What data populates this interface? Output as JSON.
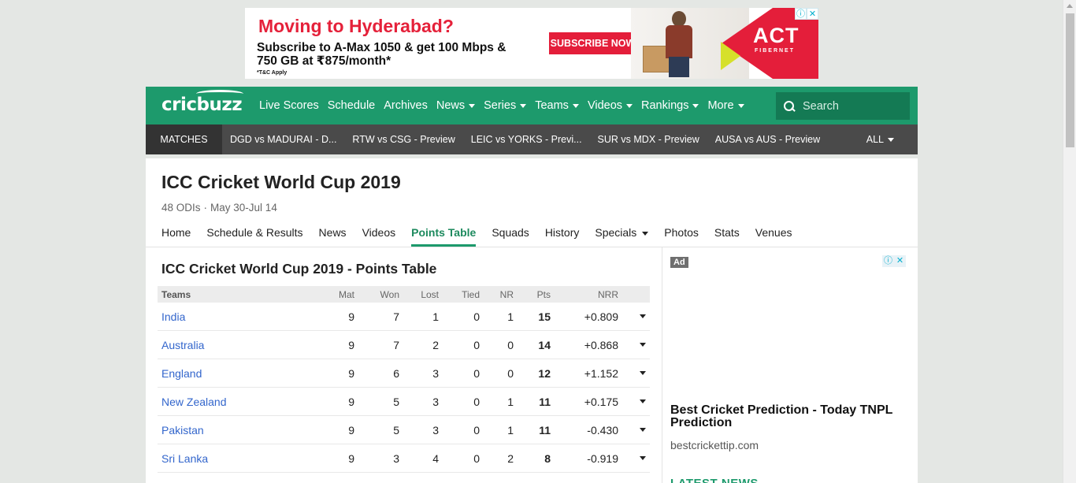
{
  "ad_banner": {
    "headline": "Moving to Hyderabad?",
    "subline": "Subscribe to A-Max 1050 & get 100 Mbps & 750 GB at ₹875/month*",
    "tnc": "*T&C Apply",
    "cta": "SUBSCRIBE NOW",
    "brand": "ACT",
    "brand_sub": "FIBERNET",
    "info_glyph": "ⓘ",
    "close_glyph": "✕"
  },
  "nav": {
    "logo": "cricbuzz",
    "items": [
      {
        "label": "Live Scores",
        "has_menu": false
      },
      {
        "label": "Schedule",
        "has_menu": false
      },
      {
        "label": "Archives",
        "has_menu": false
      },
      {
        "label": "News",
        "has_menu": true
      },
      {
        "label": "Series",
        "has_menu": true
      },
      {
        "label": "Teams",
        "has_menu": true
      },
      {
        "label": "Videos",
        "has_menu": true
      },
      {
        "label": "Rankings",
        "has_menu": true
      },
      {
        "label": "More",
        "has_menu": true
      }
    ],
    "search_placeholder": "Search"
  },
  "matches_bar": {
    "label": "MATCHES",
    "matches": [
      "DGD vs MADURAI - D...",
      "RTW vs CSG - Preview",
      "LEIC vs YORKS - Previ...",
      "SUR vs MDX - Preview",
      "AUSA vs AUS - Preview"
    ],
    "all_label": "ALL"
  },
  "series": {
    "title": "ICC Cricket World Cup 2019",
    "format": "48 ODIs",
    "separator": "·",
    "dates": "May 30-Jul 14",
    "tabs": [
      {
        "label": "Home",
        "active": false,
        "has_menu": false
      },
      {
        "label": "Schedule & Results",
        "active": false,
        "has_menu": false
      },
      {
        "label": "News",
        "active": false,
        "has_menu": false
      },
      {
        "label": "Videos",
        "active": false,
        "has_menu": false
      },
      {
        "label": "Points Table",
        "active": true,
        "has_menu": false
      },
      {
        "label": "Squads",
        "active": false,
        "has_menu": false
      },
      {
        "label": "History",
        "active": false,
        "has_menu": false
      },
      {
        "label": "Specials",
        "active": false,
        "has_menu": true
      },
      {
        "label": "Photos",
        "active": false,
        "has_menu": false
      },
      {
        "label": "Stats",
        "active": false,
        "has_menu": false
      },
      {
        "label": "Venues",
        "active": false,
        "has_menu": false
      }
    ]
  },
  "points_table": {
    "title": "ICC Cricket World Cup 2019 - Points Table",
    "headers": {
      "team": "Teams",
      "mat": "Mat",
      "won": "Won",
      "lost": "Lost",
      "tied": "Tied",
      "nr": "NR",
      "pts": "Pts",
      "nrr": "NRR"
    },
    "rows": [
      {
        "team": "India",
        "mat": "9",
        "won": "7",
        "lost": "1",
        "tied": "0",
        "nr": "1",
        "pts": "15",
        "nrr": "+0.809"
      },
      {
        "team": "Australia",
        "mat": "9",
        "won": "7",
        "lost": "2",
        "tied": "0",
        "nr": "0",
        "pts": "14",
        "nrr": "+0.868"
      },
      {
        "team": "England",
        "mat": "9",
        "won": "6",
        "lost": "3",
        "tied": "0",
        "nr": "0",
        "pts": "12",
        "nrr": "+1.152"
      },
      {
        "team": "New Zealand",
        "mat": "9",
        "won": "5",
        "lost": "3",
        "tied": "0",
        "nr": "1",
        "pts": "11",
        "nrr": "+0.175"
      },
      {
        "team": "Pakistan",
        "mat": "9",
        "won": "5",
        "lost": "3",
        "tied": "0",
        "nr": "1",
        "pts": "11",
        "nrr": "-0.430"
      },
      {
        "team": "Sri Lanka",
        "mat": "9",
        "won": "3",
        "lost": "4",
        "tied": "0",
        "nr": "2",
        "pts": "8",
        "nrr": "-0.919"
      }
    ]
  },
  "side_ad": {
    "label": "Ad",
    "title": "Best Cricket Prediction - Today TNPL Prediction",
    "url": "bestcrickettip.com",
    "info_glyph": "ⓘ",
    "close_glyph": "✕"
  },
  "latest_news": "LATEST NEWS",
  "colors": {
    "brand_green": "#1d9a6c",
    "dark_green": "#147a54",
    "match_bar": "#4a4a4a",
    "link_blue": "#3366cc",
    "ad_red": "#e41e3a"
  }
}
